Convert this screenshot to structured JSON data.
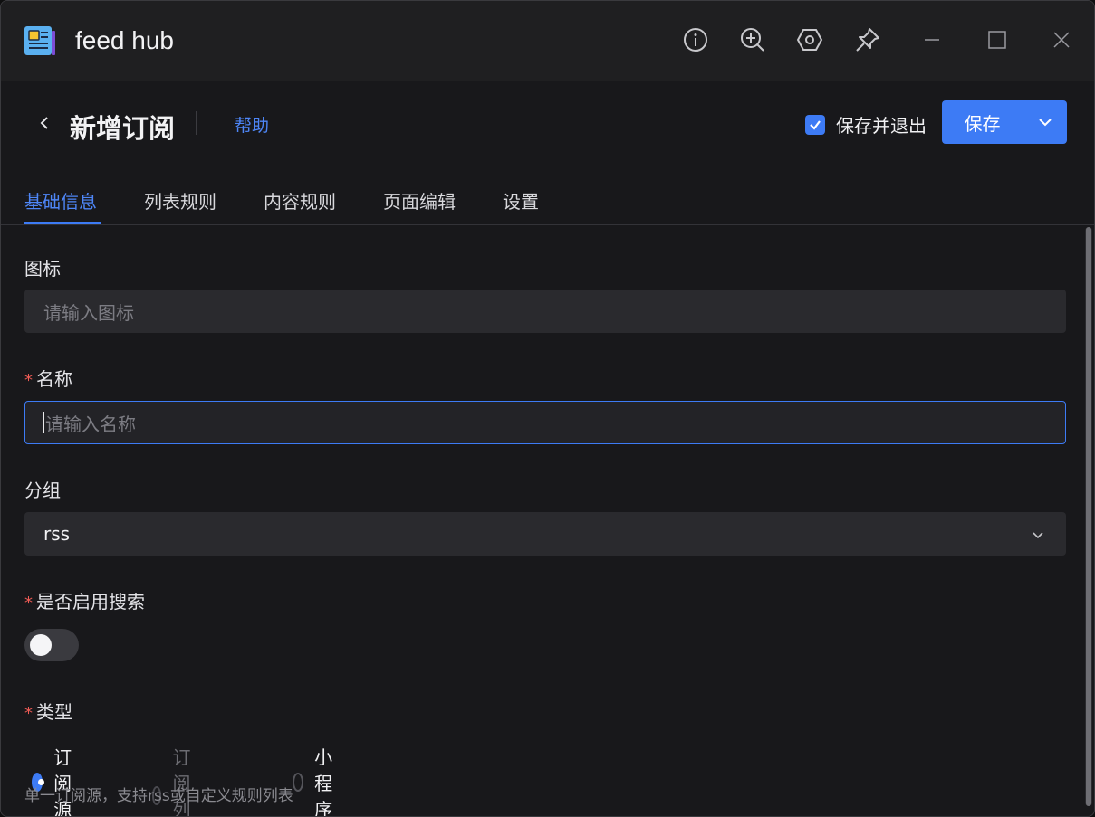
{
  "app": {
    "title": "feed hub"
  },
  "titlebar": {
    "icons": [
      "info-icon",
      "zoom-in-icon",
      "hexagon-settings-icon",
      "pin-icon",
      "minimize-icon",
      "maximize-icon",
      "close-icon"
    ]
  },
  "header": {
    "title": "新增订阅",
    "help": "帮助",
    "save_and_exit": "保存并退出",
    "save_and_exit_checked": true,
    "save": "保存"
  },
  "tabs": [
    {
      "label": "基础信息",
      "active": true
    },
    {
      "label": "列表规则",
      "active": false
    },
    {
      "label": "内容规则",
      "active": false
    },
    {
      "label": "页面编辑",
      "active": false
    },
    {
      "label": "设置",
      "active": false
    }
  ],
  "form": {
    "icon": {
      "label": "图标",
      "placeholder": "请输入图标",
      "value": ""
    },
    "name": {
      "label": "名称",
      "required_mark": "*",
      "placeholder": "请输入名称",
      "value": ""
    },
    "group": {
      "label": "分组",
      "value": "rss"
    },
    "search": {
      "label": "是否启用搜索",
      "required_mark": "*",
      "enabled": false
    },
    "type": {
      "label": "类型",
      "required_mark": "*",
      "options": [
        {
          "label": "订阅源",
          "selected": true,
          "disabled": false
        },
        {
          "label": "订阅列表",
          "selected": false,
          "disabled": true
        },
        {
          "label": "小程序",
          "selected": false,
          "disabled": false
        }
      ],
      "hint": "单一订阅源，支持rss或自定义规则列表"
    }
  },
  "colors": {
    "accent": "#3d7bf5",
    "required": "#f05b55",
    "background": "#18181b"
  }
}
